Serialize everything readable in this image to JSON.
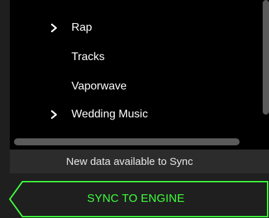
{
  "library": {
    "items": [
      {
        "label": "Rap",
        "has_children": true,
        "icon": "chevron-right-icon"
      },
      {
        "label": "Tracks",
        "has_children": false
      },
      {
        "label": "Vaporwave",
        "has_children": false
      },
      {
        "label": "Wedding Music",
        "has_children": true,
        "icon": "chevron-right-icon"
      }
    ]
  },
  "status": {
    "message": "New data available to Sync"
  },
  "sync_button": {
    "label": "SYNC TO ENGINE",
    "accent_color": "#3dff3d"
  },
  "colors": {
    "panel_background": "#000000",
    "app_background": "#1f1f1f",
    "status_background": "#2c2c2c",
    "scrollbar": "#5a5a5a",
    "text": "#ffffff"
  }
}
